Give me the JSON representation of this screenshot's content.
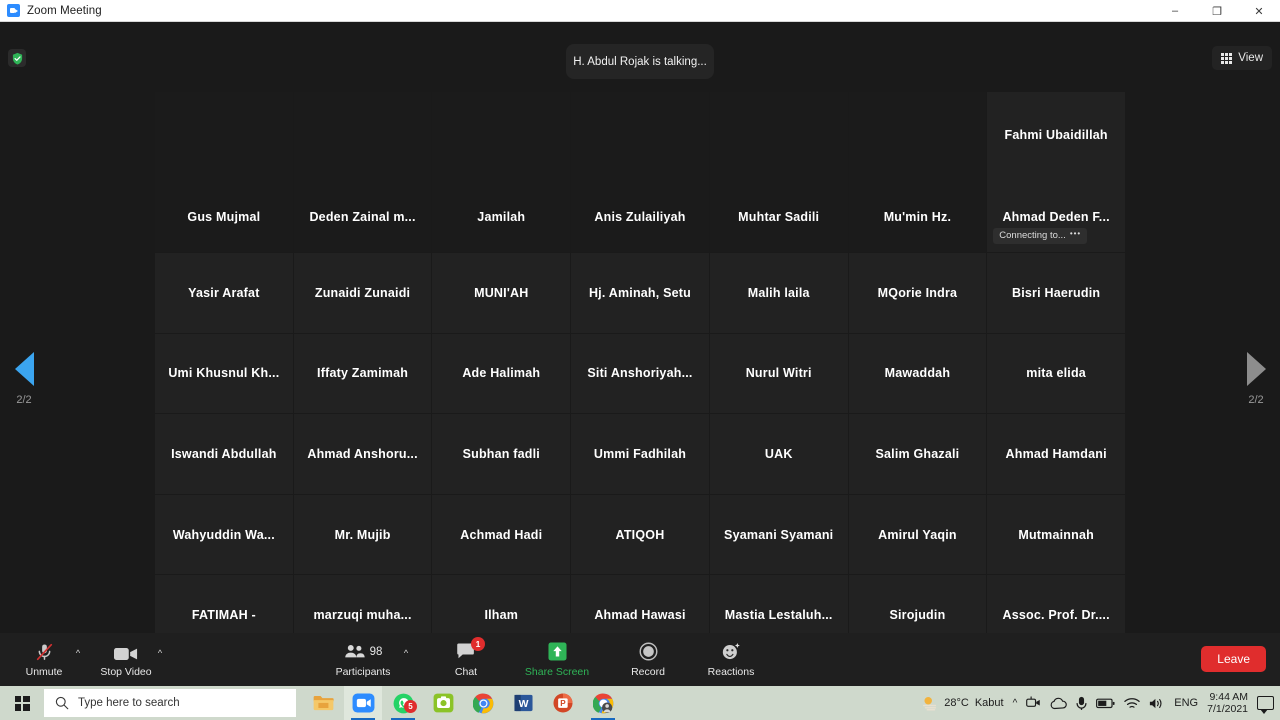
{
  "window": {
    "title": "Zoom Meeting",
    "app_icon": "zoom-video-icon",
    "minimize": "–",
    "maximize": "❐",
    "close": "✕"
  },
  "header": {
    "security_icon": "shield-check-icon",
    "talking_status": "H. Abdul Rojak is talking...",
    "view_button": "View",
    "view_icon": "grid-icon"
  },
  "pager": {
    "prev_icon": "triangle-left-icon",
    "next_icon": "triangle-right-icon",
    "prev_label": "2/2",
    "next_label": "2/2",
    "prev_color": "#3ba5f0",
    "next_color": "#8d8d8d"
  },
  "gallery": {
    "columns": 7,
    "tiles": [
      {
        "name": "Gus Mujmal",
        "video": true,
        "palette": [
          "#c45a4a",
          "#e8dcd0",
          "#3a2f2a"
        ]
      },
      {
        "name": "Deden  Zainal  m...",
        "video": true,
        "palette": [
          "#d9cfcf",
          "#e6dede",
          "#8d6f7e"
        ]
      },
      {
        "name": "Jamilah",
        "video": true,
        "palette": [
          "#d8cfa8",
          "#a03030",
          "#202020"
        ]
      },
      {
        "name": "Anis Zulailiyah",
        "video": true,
        "palette": [
          "#ddd8d0",
          "#efe9e2",
          "#2a2a2a"
        ]
      },
      {
        "name": "Muhtar Sadili",
        "video": true,
        "palette": [
          "#ddd6cb",
          "#efe8df",
          "#2f3a52"
        ]
      },
      {
        "name": "Mu'min Hz.",
        "video": true,
        "palette": [
          "#b9a58d",
          "#e8a32a",
          "#332b24"
        ]
      },
      {
        "name": "Ahmad  Deden  F...",
        "video": false,
        "display_name": "Fahmi Ubaidillah",
        "status": "Connecting to...",
        "status_dots": "•••"
      },
      {
        "name": "Yasir Arafat",
        "video": false
      },
      {
        "name": "Zunaidi Zunaidi",
        "video": false
      },
      {
        "name": "MUNI'AH",
        "video": false
      },
      {
        "name": "Hj. Aminah, Setu",
        "video": false
      },
      {
        "name": "Malih laila",
        "video": false
      },
      {
        "name": "MQorie Indra",
        "video": false
      },
      {
        "name": "Bisri Haerudin",
        "video": false
      },
      {
        "name": "Umi  Khusnul  Kh...",
        "video": false
      },
      {
        "name": "Iffaty Zamimah",
        "video": false
      },
      {
        "name": "Ade Halimah",
        "video": false
      },
      {
        "name": "Siti  Anshoriyah...",
        "video": false
      },
      {
        "name": "Nurul Witri",
        "video": false
      },
      {
        "name": "Mawaddah",
        "video": false
      },
      {
        "name": "mita elida",
        "video": false
      },
      {
        "name": "Iswandi Abdullah",
        "video": false
      },
      {
        "name": "Ahmad  Anshoru...",
        "video": false
      },
      {
        "name": "Subhan fadli",
        "video": false
      },
      {
        "name": "Ummi Fadhilah",
        "video": false
      },
      {
        "name": "UAK",
        "video": false
      },
      {
        "name": "Salim Ghazali",
        "video": false
      },
      {
        "name": "Ahmad Hamdani",
        "video": false
      },
      {
        "name": "Wahyuddin  Wa...",
        "video": false
      },
      {
        "name": "Mr. Mujib",
        "video": false
      },
      {
        "name": "Achmad Hadi",
        "video": false
      },
      {
        "name": "ATIQOH",
        "video": false
      },
      {
        "name": "Syamani Syamani",
        "video": false
      },
      {
        "name": "Amirul Yaqin",
        "video": false
      },
      {
        "name": "Mutmainnah",
        "video": false
      },
      {
        "name": "FATIMAH -",
        "video": false
      },
      {
        "name": "marzuqi  muha...",
        "video": false
      },
      {
        "name": "Ilham",
        "video": false
      },
      {
        "name": "Ahmad Hawasi",
        "video": false
      },
      {
        "name": "Mastia  Lestaluh...",
        "video": false
      },
      {
        "name": "Sirojudin",
        "video": false
      },
      {
        "name": "Assoc.  Prof.  Dr....",
        "video": false
      }
    ]
  },
  "toolbar": {
    "unmute_label": "Unmute",
    "unmute_icon": "microphone-muted-icon",
    "audio_caret_icon": "chevron-up-icon",
    "stop_video_label": "Stop Video",
    "stop_video_icon": "camera-icon",
    "video_caret_icon": "chevron-up-icon",
    "participants_label": "Participants",
    "participants_icon": "people-icon",
    "participants_count": "98",
    "participants_caret_icon": "chevron-up-icon",
    "chat_label": "Chat",
    "chat_icon": "chat-bubble-icon",
    "chat_badge": "1",
    "share_screen_label": "Share Screen",
    "share_screen_icon": "share-screen-up-arrow-icon",
    "share_screen_color": "#2fb457",
    "record_label": "Record",
    "record_icon": "record-circle-icon",
    "reactions_label": "Reactions",
    "reactions_icon": "smiley-reaction-icon",
    "leave_label": "Leave",
    "leave_color": "#e02d2d"
  },
  "taskbar": {
    "start_icon": "windows-logo-icon",
    "search_icon": "search-icon",
    "search_placeholder": "Type here to search",
    "apps": [
      {
        "name": "file-explorer",
        "badge": "",
        "active": false,
        "running": false
      },
      {
        "name": "zoom",
        "badge": "",
        "active": true,
        "running": true
      },
      {
        "name": "whatsapp",
        "badge": "5",
        "active": false,
        "running": true
      },
      {
        "name": "camera-green-app",
        "badge": "",
        "active": false,
        "running": false
      },
      {
        "name": "chrome",
        "badge": "",
        "active": false,
        "running": false
      },
      {
        "name": "microsoft-word",
        "badge": "",
        "active": false,
        "running": false
      },
      {
        "name": "microsoft-powerpoint",
        "badge": "",
        "active": false,
        "running": false
      },
      {
        "name": "chrome-profile",
        "badge": "",
        "active": false,
        "running": true
      }
    ],
    "weather_temp": "28°C",
    "weather_desc": "Kabut",
    "weather_icon": "sun-fog-icon",
    "tray_expand_icon": "chevron-up-icon",
    "tray_icons": [
      "meet-now-icon",
      "onedrive-cloud-icon",
      "microphone-icon",
      "battery-icon",
      "wifi-icon",
      "speaker-icon"
    ],
    "language": "ENG",
    "time": "9:44 AM",
    "date": "7/1/2021",
    "notification_icon": "notification-center-icon"
  }
}
